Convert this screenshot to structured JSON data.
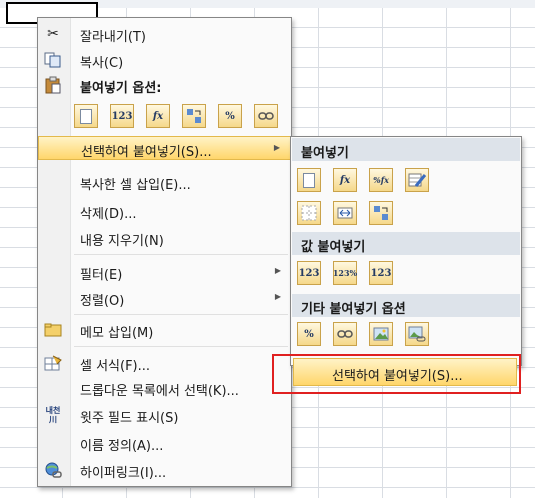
{
  "menu": {
    "cut": {
      "label": "잘라내기(T)",
      "icon": "scissors-icon"
    },
    "copy": {
      "label": "복사(C)",
      "icon": "copy-icon"
    },
    "paste_options_header": "붙여넣기 옵션:",
    "paste_options": [
      {
        "icon": "paste-icon",
        "text": ""
      },
      {
        "icon": "paste-values-icon",
        "text": "123"
      },
      {
        "icon": "paste-formulas-icon",
        "text": "fx"
      },
      {
        "icon": "paste-transpose-icon",
        "text": ""
      },
      {
        "icon": "paste-formatting-icon",
        "text": "%"
      },
      {
        "icon": "paste-link-icon",
        "text": ""
      }
    ],
    "paste_special": {
      "label": "선택하여 붙여넣기(S)...",
      "icon": "chevron-right-icon"
    },
    "insert_copied_cells": "복사한 셀 삽입(E)...",
    "delete": "삭제(D)...",
    "clear_contents": "내용 지우기(N)",
    "filter": "필터(E)",
    "sort": "정렬(O)",
    "insert_comment": {
      "label": "메모 삽입(M)",
      "icon": "comment-icon"
    },
    "format_cells": {
      "label": "셀 서식(F)...",
      "icon": "format-cells-icon"
    },
    "dropdown_pick": "드롭다운 목록에서 선택(K)...",
    "phonetic": {
      "label": "윗주 필드 표시(S)",
      "icon": "phonetic-icon",
      "glyph": "내천\n川"
    },
    "define_name": "이름 정의(A)...",
    "hyperlink": {
      "label": "하이퍼링크(I)...",
      "icon": "hyperlink-icon"
    }
  },
  "submenu": {
    "paste_header": "붙여넣기",
    "paste_row1": [
      {
        "icon": "paste-icon",
        "text": ""
      },
      {
        "icon": "paste-formulas-icon",
        "text": "fx"
      },
      {
        "icon": "paste-formulas-number-format-icon",
        "text": "%fx"
      },
      {
        "icon": "keep-source-formatting-icon",
        "text": ""
      }
    ],
    "paste_row2": [
      {
        "icon": "no-borders-icon",
        "text": ""
      },
      {
        "icon": "keep-column-widths-icon",
        "text": ""
      },
      {
        "icon": "transpose-icon",
        "text": ""
      }
    ],
    "values_header": "값 붙여넣기",
    "values_row": [
      {
        "icon": "paste-values-icon",
        "text": "123"
      },
      {
        "icon": "values-number-format-icon",
        "text": "123%"
      },
      {
        "icon": "values-source-formatting-icon",
        "text": "123"
      }
    ],
    "other_header": "기타 붙여넣기 옵션",
    "other_row": [
      {
        "icon": "formatting-icon",
        "text": "%"
      },
      {
        "icon": "paste-link-icon",
        "text": ""
      },
      {
        "icon": "picture-icon",
        "text": ""
      },
      {
        "icon": "linked-picture-icon",
        "text": ""
      }
    ],
    "paste_special_item": "선택하여 붙여넣기(S)..."
  }
}
